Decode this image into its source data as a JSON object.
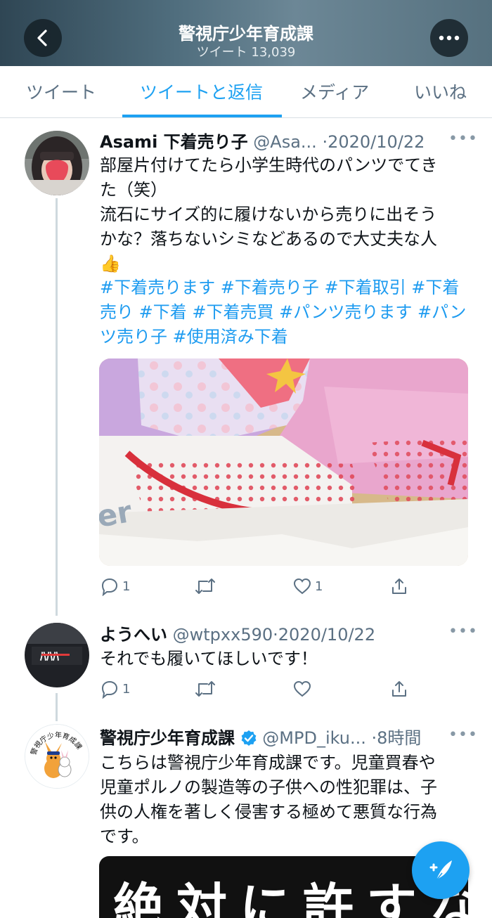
{
  "header": {
    "title": "警視庁少年育成課",
    "subtitle": "ツイート 13,039"
  },
  "tabs": [
    {
      "label": "ツイート",
      "active": false
    },
    {
      "label": "ツイートと返信",
      "active": true
    },
    {
      "label": "メディア",
      "active": false
    },
    {
      "label": "いいね",
      "active": false
    }
  ],
  "tweets": [
    {
      "name": "Asami 下着売り子",
      "handle": "@Asa...",
      "date": "·2020/10/22",
      "body": [
        "部屋片付けてたら小学生時代のパンツでてき",
        "た（笑）",
        "流石にサイズ的に履けないから売りに出そう",
        "かな？落ちないシミなどあるので大丈夫な人",
        "👍"
      ],
      "hashtags": [
        "#下着売ります #下着売り子 #下着取引 #下着",
        "売り #下着 #下着売買 #パンツ売ります #パン",
        "ツ売り子 #使用済み下着"
      ],
      "reply_count": "1",
      "like_count": "1"
    },
    {
      "name": "ようへい",
      "handle": "@wtpxx590",
      "date": "·2020/10/22",
      "body": [
        "それでも履いてほしいです！"
      ],
      "reply_count": "1",
      "like_count": ""
    },
    {
      "name": "警視庁少年育成課",
      "handle": "@MPD_iku...",
      "date": "·8時間",
      "body": [
        "こちらは警視庁少年育成課です。児童買春や",
        "児童ポルノの製造等の子供への性犯罪は、子",
        "供の人権を著しく侵害する極めて悪質な行為",
        "です。"
      ],
      "avatar_text": "警視庁少年育成課",
      "banner_text": "絶対に許すな"
    }
  ],
  "colors": {
    "accent": "#1da1f2",
    "hashtag": "#1d9bf0",
    "secondary": "#5b7083",
    "verified": "#1da1f2"
  },
  "icons": [
    "back-arrow-icon",
    "more-icon",
    "reply-icon",
    "retweet-icon",
    "like-icon",
    "share-icon",
    "verified-icon",
    "compose-icon"
  ]
}
